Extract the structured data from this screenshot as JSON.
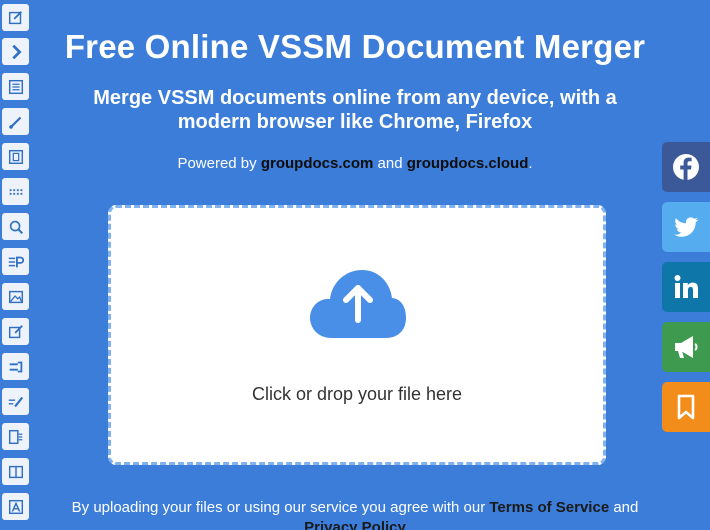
{
  "header": {
    "title": "Free Online VSSM Document Merger",
    "subtitle": "Merge VSSM documents online from any device, with a modern browser like Chrome, Firefox"
  },
  "powered": {
    "prefix": "Powered by ",
    "link1": "groupdocs.com",
    "middle": " and ",
    "link2": "groupdocs.cloud",
    "suffix": "."
  },
  "upload": {
    "drop_text": "Click or drop your file here",
    "icon": "cloud-upload-icon"
  },
  "footer": {
    "prefix": "By uploading your files or using our service you agree with our ",
    "terms": "Terms of Service",
    "middle": " and",
    "privacy": "Privacy Policy"
  },
  "toolbar": {
    "icons": [
      "edit-icon",
      "chevron-right-icon",
      "list-icon",
      "brush-icon",
      "film-icon",
      "dots-icon",
      "search-doc-icon",
      "text-p-icon",
      "image-icon",
      "edit-doc-icon",
      "merge-icon",
      "pen-lines-icon",
      "split-icon",
      "compare-icon",
      "translate-icon"
    ]
  },
  "share": {
    "icons": [
      "facebook-icon",
      "twitter-icon",
      "linkedin-icon",
      "megaphone-icon",
      "bookmark-icon"
    ]
  },
  "colors": {
    "background": "#3b7dd8",
    "facebook": "#3b5998",
    "twitter": "#55acee",
    "linkedin": "#0e76a8",
    "megaphone": "#3e9a4f",
    "bookmark": "#f28c1b",
    "cloud": "#4a8fe7"
  }
}
